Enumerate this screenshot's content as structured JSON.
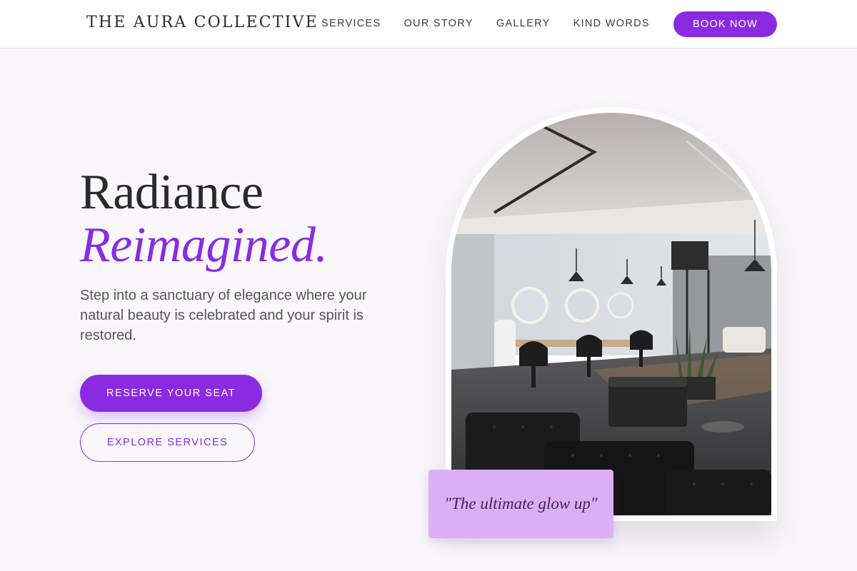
{
  "header": {
    "brand": "THE AURA COLLECTIVE",
    "nav": [
      {
        "label": "SERVICES"
      },
      {
        "label": "OUR STORY"
      },
      {
        "label": "GALLERY"
      },
      {
        "label": "KIND WORDS"
      }
    ],
    "book_label": "BOOK NOW"
  },
  "hero": {
    "title_line1": "Radiance",
    "title_line2": "Reimagined.",
    "intro": "Step into a sanctuary of elegance where your natural beauty is celebrated and your spirit is restored.",
    "primary_cta": "RESERVE YOUR SEAT",
    "secondary_cta": "EXPLORE SERVICES",
    "quote": "\"The ultimate glow up\""
  },
  "colors": {
    "accent": "#8a2be2",
    "quote_card": "#dcaef8",
    "page_bg": "#f9f7fb"
  }
}
